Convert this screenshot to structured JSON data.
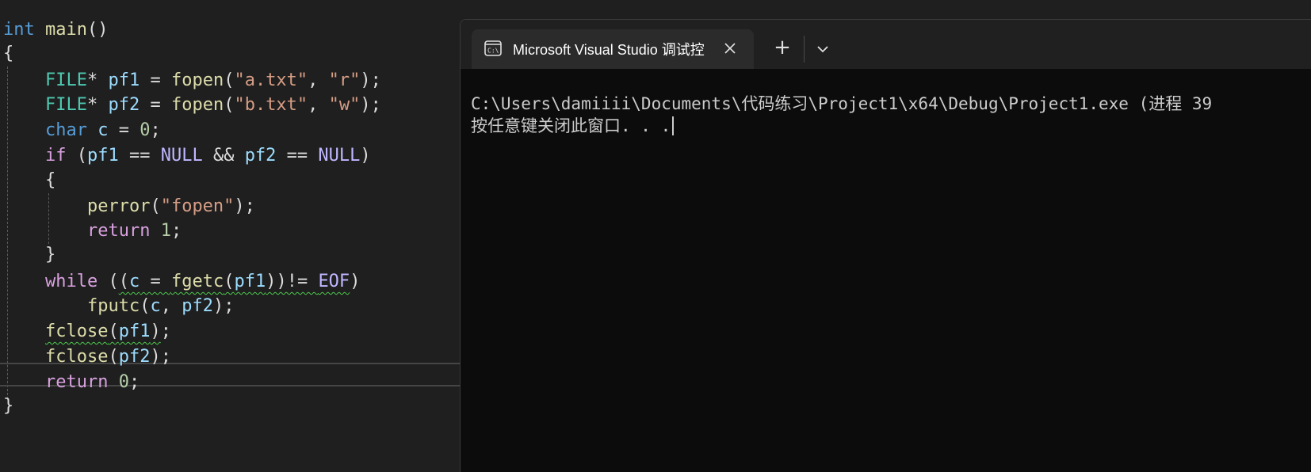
{
  "editor": {
    "lines": [
      {
        "segments": [
          {
            "t": "int",
            "c": "kw"
          },
          {
            "t": " ",
            "c": ""
          },
          {
            "t": "main",
            "c": "fn"
          },
          {
            "t": "()",
            "c": ""
          }
        ]
      },
      {
        "segments": [
          {
            "t": "{",
            "c": ""
          }
        ]
      },
      {
        "segments": [
          {
            "t": "    ",
            "c": ""
          },
          {
            "t": "FILE",
            "c": "type"
          },
          {
            "t": "* ",
            "c": ""
          },
          {
            "t": "pf1",
            "c": "var"
          },
          {
            "t": " = ",
            "c": ""
          },
          {
            "t": "fopen",
            "c": "fn"
          },
          {
            "t": "(",
            "c": ""
          },
          {
            "t": "\"a.txt\"",
            "c": "str"
          },
          {
            "t": ", ",
            "c": ""
          },
          {
            "t": "\"r\"",
            "c": "str"
          },
          {
            "t": ");",
            "c": ""
          }
        ]
      },
      {
        "segments": [
          {
            "t": "    ",
            "c": ""
          },
          {
            "t": "FILE",
            "c": "type"
          },
          {
            "t": "* ",
            "c": ""
          },
          {
            "t": "pf2",
            "c": "var"
          },
          {
            "t": " = ",
            "c": ""
          },
          {
            "t": "fopen",
            "c": "fn"
          },
          {
            "t": "(",
            "c": ""
          },
          {
            "t": "\"b.txt\"",
            "c": "str"
          },
          {
            "t": ", ",
            "c": ""
          },
          {
            "t": "\"w\"",
            "c": "str"
          },
          {
            "t": ");",
            "c": ""
          }
        ]
      },
      {
        "segments": [
          {
            "t": "    ",
            "c": ""
          },
          {
            "t": "char",
            "c": "kw"
          },
          {
            "t": " ",
            "c": ""
          },
          {
            "t": "c",
            "c": "var"
          },
          {
            "t": " = ",
            "c": ""
          },
          {
            "t": "0",
            "c": "num"
          },
          {
            "t": ";",
            "c": ""
          }
        ]
      },
      {
        "segments": [
          {
            "t": "    ",
            "c": ""
          },
          {
            "t": "if",
            "c": "ctrl"
          },
          {
            "t": " (",
            "c": ""
          },
          {
            "t": "pf1",
            "c": "var"
          },
          {
            "t": " == ",
            "c": ""
          },
          {
            "t": "NULL",
            "c": "macb"
          },
          {
            "t": " && ",
            "c": ""
          },
          {
            "t": "pf2",
            "c": "var"
          },
          {
            "t": " == ",
            "c": ""
          },
          {
            "t": "NULL",
            "c": "macb"
          },
          {
            "t": ")",
            "c": ""
          }
        ]
      },
      {
        "segments": [
          {
            "t": "    {",
            "c": ""
          }
        ]
      },
      {
        "segments": [
          {
            "t": "        ",
            "c": ""
          },
          {
            "t": "perror",
            "c": "fn"
          },
          {
            "t": "(",
            "c": ""
          },
          {
            "t": "\"fopen\"",
            "c": "str"
          },
          {
            "t": ");",
            "c": ""
          }
        ]
      },
      {
        "segments": [
          {
            "t": "        ",
            "c": ""
          },
          {
            "t": "return",
            "c": "ctrl"
          },
          {
            "t": " ",
            "c": ""
          },
          {
            "t": "1",
            "c": "num"
          },
          {
            "t": ";",
            "c": ""
          }
        ]
      },
      {
        "segments": [
          {
            "t": "    }",
            "c": ""
          }
        ]
      },
      {
        "segments": [
          {
            "t": "    ",
            "c": ""
          },
          {
            "t": "while",
            "c": "ctrl"
          },
          {
            "t": " (",
            "c": ""
          },
          {
            "t": "(",
            "c": "squig"
          },
          {
            "t": "c",
            "c": "var squig"
          },
          {
            "t": " = ",
            "c": "squig"
          },
          {
            "t": "fgetc",
            "c": "fn squig"
          },
          {
            "t": "(",
            "c": "squig"
          },
          {
            "t": "pf1",
            "c": "var squig"
          },
          {
            "t": "))!= ",
            "c": "squig"
          },
          {
            "t": "EOF",
            "c": "macb squig"
          },
          {
            "t": ")",
            "c": ""
          }
        ]
      },
      {
        "segments": [
          {
            "t": "        ",
            "c": ""
          },
          {
            "t": "fputc",
            "c": "fn"
          },
          {
            "t": "(",
            "c": ""
          },
          {
            "t": "c",
            "c": "var"
          },
          {
            "t": ", ",
            "c": ""
          },
          {
            "t": "pf2",
            "c": "var"
          },
          {
            "t": ");",
            "c": ""
          }
        ]
      },
      {
        "segments": [
          {
            "t": "    ",
            "c": ""
          },
          {
            "t": "fclose",
            "c": "fn squig"
          },
          {
            "t": "(",
            "c": "squig"
          },
          {
            "t": "pf1",
            "c": "var squig"
          },
          {
            "t": ")",
            "c": "squig"
          },
          {
            "t": ";",
            "c": ""
          }
        ]
      },
      {
        "segments": [
          {
            "t": "    ",
            "c": ""
          },
          {
            "t": "fclose",
            "c": "fn"
          },
          {
            "t": "(",
            "c": ""
          },
          {
            "t": "pf2",
            "c": "var"
          },
          {
            "t": ");",
            "c": ""
          }
        ]
      },
      {
        "segments": [
          {
            "t": "    ",
            "c": ""
          },
          {
            "t": "return",
            "c": "ctrl"
          },
          {
            "t": " ",
            "c": ""
          },
          {
            "t": "0",
            "c": "num"
          },
          {
            "t": ";",
            "c": ""
          }
        ]
      },
      {
        "segments": [
          {
            "t": "}",
            "c": ""
          }
        ]
      }
    ]
  },
  "terminal": {
    "tab_title": "Microsoft Visual Studio 调试控",
    "tab_icon": "terminal-icon",
    "close_icon": "close-icon",
    "new_tab_label": "+",
    "dropdown_icon": "chevron-down-icon",
    "output_line1": "C:\\Users\\damiiii\\Documents\\代码练习\\Project1\\x64\\Debug\\Project1.exe (进程 39",
    "output_line2": "按任意键关闭此窗口. . ."
  },
  "colors": {
    "editor_bg": "#1f1f1f",
    "terminal_bg": "#0c0c0c",
    "tab_bg": "#2b2b2b",
    "keyword": "#569cd6",
    "control": "#d8a0df",
    "function": "#dcdcaa",
    "type": "#4ec9b0",
    "variable": "#9cdcfe",
    "string": "#d69d85",
    "number": "#b5cea8",
    "macro": "#beb7ff"
  }
}
